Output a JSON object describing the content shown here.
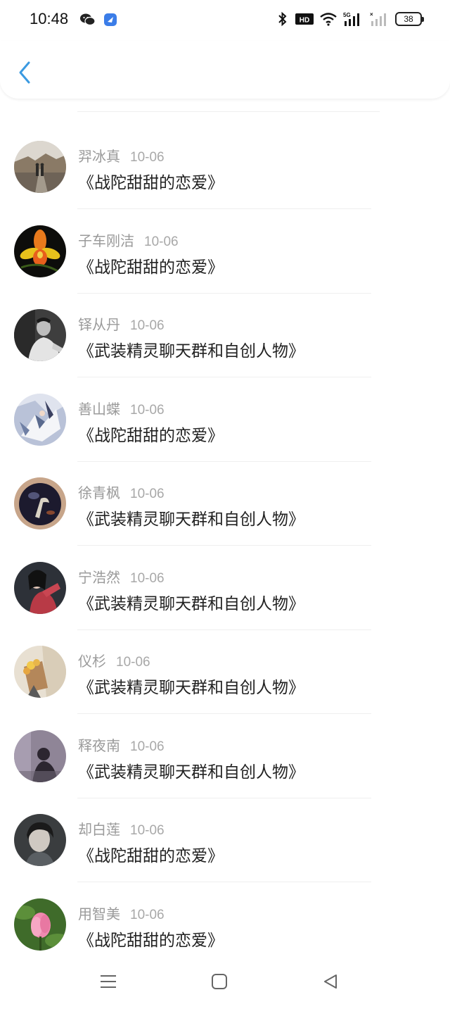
{
  "status_bar": {
    "time": "10:48",
    "hd_label": "HD",
    "network": "5G",
    "battery": "38"
  },
  "header": {
    "back_icon": "chevron-left-icon",
    "accent_color": "#3b9ae1"
  },
  "items": [
    {
      "name": "羿冰真",
      "date": "10-06",
      "title": "《战陀甜甜的恋爱》",
      "avatar": "couple-walking-path"
    },
    {
      "name": "子车刚洁",
      "date": "10-06",
      "title": "《战陀甜甜的恋爱》",
      "avatar": "orange-orchid"
    },
    {
      "name": "铎从丹",
      "date": "10-06",
      "title": "《武装精灵聊天群和自创人物》",
      "avatar": "man-monochrome"
    },
    {
      "name": "善山蝶",
      "date": "10-06",
      "title": "《战陀甜甜的恋爱》",
      "avatar": "anime-character"
    },
    {
      "name": "徐青枫",
      "date": "10-06",
      "title": "《武装精灵聊天群和自创人物》",
      "avatar": "glass-ball"
    },
    {
      "name": "宁浩然",
      "date": "10-06",
      "title": "《武装精灵聊天群和自创人物》",
      "avatar": "girl-red-dress"
    },
    {
      "name": "仪杉",
      "date": "10-06",
      "title": "《武装精灵聊天群和自创人物》",
      "avatar": "flower-bouquet"
    },
    {
      "name": "释夜南",
      "date": "10-06",
      "title": "《武装精灵聊天群和自创人物》",
      "avatar": "silhouette-purple"
    },
    {
      "name": "却白莲",
      "date": "10-06",
      "title": "《战陀甜甜的恋爱》",
      "avatar": "boy-portrait"
    },
    {
      "name": "用智美",
      "date": "10-06",
      "title": "《战陀甜甜的恋爱》",
      "avatar": "pink-lotus"
    }
  ],
  "nav_bar": {
    "menu_icon": "menu-icon",
    "home_icon": "home-square-icon",
    "back_icon": "back-triangle-icon"
  }
}
